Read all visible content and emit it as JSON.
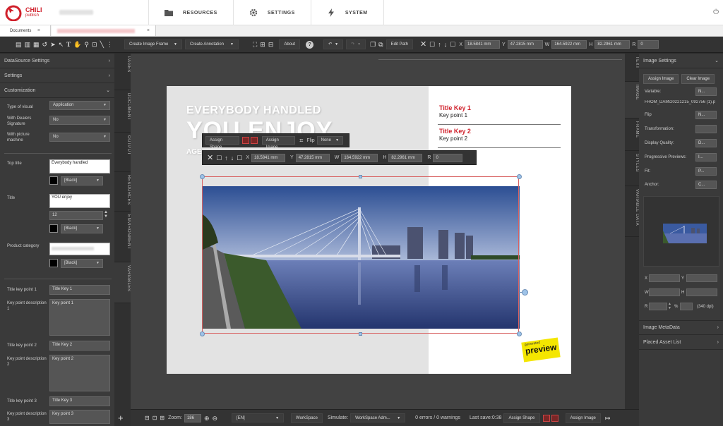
{
  "app": {
    "logo_text": "CHILI",
    "logo_sub": "publish"
  },
  "topnav": [
    {
      "label": "RESOURCES",
      "icon": "folder-icon"
    },
    {
      "label": "SETTINGS",
      "icon": "gear-icon"
    },
    {
      "label": "SYSTEM",
      "icon": "bolt-icon"
    }
  ],
  "tabs": {
    "documents": "Documents",
    "close": "×"
  },
  "toolbar": {
    "create_image_frame": "Create Image Frame",
    "create_annotation": "Create Annotation",
    "about": "About",
    "help": "?",
    "edit_path": "Edit Path",
    "x_label": "X",
    "x_value": "18.5841 mm",
    "y_label": "Y",
    "y_value": "47.2815 mm",
    "w_label": "W",
    "w_value": "164.5922 mm",
    "h_label": "H",
    "h_value": "82.2961 mm",
    "r_label": "R",
    "r_value": "0"
  },
  "left": {
    "datasource": "DataSource Settings",
    "settings": "Settings",
    "customization": "Customization",
    "type_label": "Type of visual",
    "type_value": "Application",
    "dealers_label": "With Dealers Signature",
    "dealers_value": "No",
    "picture_label": "With picture machine",
    "picture_value": "No",
    "top_title_label": "Top title",
    "top_title_value": "Everybody handled",
    "top_color": "[Black]",
    "title_label": "Title",
    "title_value": "YOU enjoy",
    "title_size": "12",
    "title_color": "[Black]",
    "product_label": "Product category",
    "product_color": "[Black]",
    "kp1_label": "Title key point 1",
    "kp1_value": "Title Key 1",
    "kpd1_label": "Key point description 1",
    "kpd1_value": "Key point 1",
    "kp2_label": "Title key point  2",
    "kp2_value": "Title Key 2",
    "kpd2_label": "Key point description 2",
    "kpd2_value": "Key point 2",
    "kp3_label": "Title key point  3",
    "kp3_value": "Title Key 3",
    "kpd3_label": "Key point description 3",
    "kpd3_value": "Key point 3",
    "add": "+"
  },
  "leftstrip": [
    "PAGES",
    "DOCUMENT",
    "OUTPUT",
    "RESOURCES",
    "ENVIRONMENT",
    "VARIABLES"
  ],
  "rightstrip": [
    "TEXT",
    "IMAGE",
    "FRAME",
    "STYLES",
    "VARIABLE DATA"
  ],
  "doc": {
    "headline1": "EVERYBODY HANDLED",
    "headline2": "YOU ENJOY",
    "headline3": "AGE",
    "kp_title1": "Title Key 1",
    "kp_text1": "Key point 1",
    "kp_title2": "Title Key 2",
    "kp_text2": "Key point 2",
    "stamp_small": "generated",
    "stamp": "preview"
  },
  "floatbar": {
    "assign_shape": "Assign Shape",
    "assign_image": "Assign Image",
    "flip": "Flip",
    "flip_value": "None",
    "x_label": "X",
    "x_value": "18.5841 mm",
    "y_label": "Y",
    "y_value": "47.2815 mm",
    "w_label": "W",
    "w_value": "164.5922 mm",
    "h_label": "H",
    "h_value": "82.2961 mm",
    "r_label": "R",
    "r_value": "0"
  },
  "right": {
    "title": "Image Settings",
    "assign_image": "Assign Image",
    "clear_image": "Clear Image",
    "variable_label": "Variable:",
    "variable_value": "N...",
    "file_name": "FROM_DAM\\20221215_092756 (1).p",
    "flip_label": "Flip",
    "flip_value": "N...",
    "transform_label": "Transformation:",
    "quality_label": "Display Quality:",
    "quality_value": "D...",
    "progressive_label": "Progressive Previews:",
    "progressive_value": "I...",
    "fit_label": "Fit:",
    "fit_value": "P...",
    "anchor_label": "Anchor:",
    "anchor_value": "C...",
    "x_label": "X",
    "y_label": "Y",
    "w_label": "W",
    "h_label": "H",
    "r_label": "R",
    "pct": "%",
    "dpi": "(340 dpi)",
    "metadata": "Image MetaData",
    "placed": "Placed Asset List",
    "add": "+"
  },
  "bottom": {
    "zoom_label": "Zoom:",
    "zoom_value": "186",
    "lang_value": "[EN]",
    "workspace": "WorkSpace",
    "simulate_label": "Simulate:",
    "simulate_value": "WorkSpace Adm...",
    "errors": "0 errors / 0 warnings",
    "last_save": "Last save:0:38",
    "assign_shape": "Assign Shape",
    "assign_image": "Assign Image"
  },
  "colors": {
    "accent_red": "#d0202b",
    "handle_blue": "#9ec3e8"
  }
}
